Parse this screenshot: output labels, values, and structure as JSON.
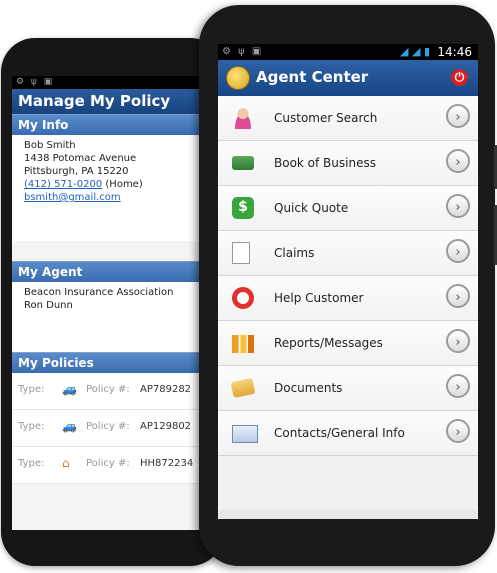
{
  "back": {
    "title": "Manage My Policy",
    "my_info": {
      "heading": "My Info",
      "name": "Bob Smith",
      "address1": "1438 Potomac Avenue",
      "address2": "Pittsburgh, PA 15220",
      "phone": "(412) 571-0200",
      "phone_type": "(Home)",
      "email": "bsmith@gmail.com"
    },
    "my_agent": {
      "heading": "My Agent",
      "company": "Beacon Insurance Association",
      "name": "Ron Dunn"
    },
    "my_policies": {
      "heading": "My Policies",
      "type_label": "Type:",
      "policy_label": "Policy #:",
      "rows": [
        {
          "icon": "car-icon",
          "number": "AP789282"
        },
        {
          "icon": "car-icon",
          "number": "AP129802"
        },
        {
          "icon": "house-icon",
          "number": "HH872234"
        }
      ]
    }
  },
  "front": {
    "time": "14:46",
    "title": "Agent Center",
    "menu": [
      {
        "label": "Customer Search",
        "icon": "person-icon"
      },
      {
        "label": "Book of Business",
        "icon": "money-icon"
      },
      {
        "label": "Quick Quote",
        "icon": "quote-icon"
      },
      {
        "label": "Claims",
        "icon": "claims-icon"
      },
      {
        "label": "Help Customer",
        "icon": "lifebuoy-icon"
      },
      {
        "label": "Reports/Messages",
        "icon": "bar-chart-icon"
      },
      {
        "label": "Documents",
        "icon": "documents-icon"
      },
      {
        "label": "Contacts/General Info",
        "icon": "contact-card-icon"
      }
    ],
    "chevron": "›"
  }
}
